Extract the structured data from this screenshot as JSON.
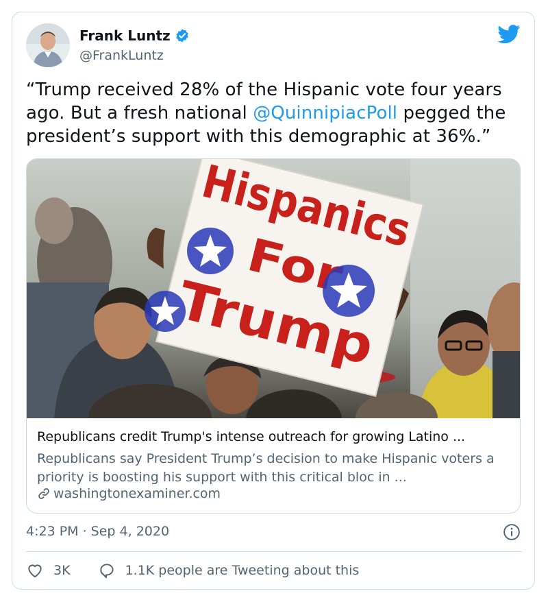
{
  "author": {
    "name": "Frank Luntz",
    "handle": "@FrankLuntz"
  },
  "tweet": {
    "text_before": "“Trump received 28% of the Hispanic vote four years ago. But a fresh national ",
    "mention": "@QuinnipiacPoll",
    "text_after": " pegged the president’s support with this demographic at 36%.”"
  },
  "link_card": {
    "image_sign": [
      "Hispanics",
      "For",
      "Trump"
    ],
    "title": "Republicans credit Trump's intense outreach for growing Latino ...",
    "description": "Republicans say President Trump’s decision to make Hispanic voters a priority is boosting his support with this critical bloc in ...",
    "domain": "washingtonexaminer.com"
  },
  "timestamp": "4:23 PM · Sep 4, 2020",
  "actions": {
    "likes": "3K",
    "conversation": "1.1K people are Tweeting about this"
  },
  "colors": {
    "accent": "#1d9bf0",
    "text": "#0f1419",
    "muted": "#536471",
    "border": "#cfd9de",
    "sign_red": "#c8211b",
    "sign_blue": "#2a39b8"
  },
  "icons": [
    "verified-badge-icon",
    "twitter-bird-icon",
    "link-icon",
    "info-icon",
    "heart-icon",
    "reply-bubble-icon"
  ]
}
